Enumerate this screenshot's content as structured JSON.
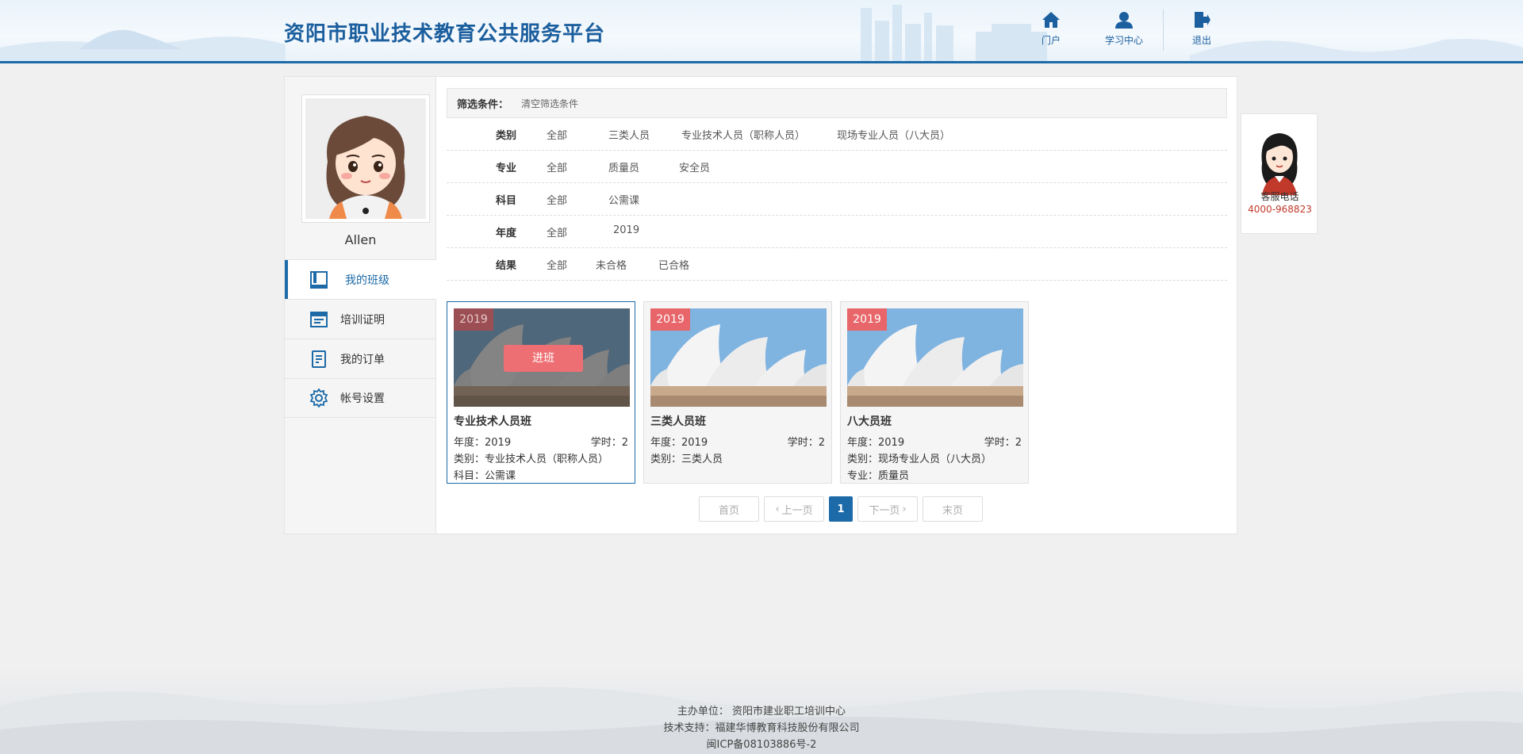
{
  "header": {
    "site_title": "资阳市职业技术教育公共服务平台",
    "nav": [
      {
        "label": "门户",
        "icon": "home-icon"
      },
      {
        "label": "学习中心",
        "icon": "user-icon"
      },
      {
        "label": "退出",
        "icon": "logout-icon"
      }
    ]
  },
  "sidebar": {
    "username": "Allen",
    "menu": [
      {
        "label": "我的班级",
        "icon": "book-icon",
        "active": true
      },
      {
        "label": "培训证明",
        "icon": "certificate-icon",
        "active": false
      },
      {
        "label": "我的订单",
        "icon": "order-icon",
        "active": false
      },
      {
        "label": "帐号设置",
        "icon": "gear-icon",
        "active": false
      }
    ]
  },
  "filter": {
    "title": "筛选条件：",
    "clear": "清空筛选条件",
    "rows": [
      {
        "label": "类别",
        "options": [
          "全部",
          "三类人员",
          "专业技术人员（职称人员）",
          "现场专业人员（八大员）"
        ]
      },
      {
        "label": "专业",
        "options": [
          "全部",
          "质量员",
          "安全员"
        ]
      },
      {
        "label": "科目",
        "options": [
          "全部",
          "公需课"
        ]
      },
      {
        "label": "年度",
        "options": [
          "全部",
          "2019"
        ]
      },
      {
        "label": "结果",
        "options": [
          "全部",
          "未合格",
          "已合格"
        ]
      }
    ]
  },
  "cards": [
    {
      "year": "2019",
      "title": "专业技术人员班",
      "line1": "年度：2019",
      "hours": "学时：2",
      "line2": "类别：专业技术人员（职称人员）",
      "line3": "科目：公需课",
      "enter_label": "进班",
      "selected": true
    },
    {
      "year": "2019",
      "title": "三类人员班",
      "line1": "年度：2019",
      "hours": "学时：2",
      "line2": "类别：三类人员",
      "line3": "",
      "selected": false
    },
    {
      "year": "2019",
      "title": "八大员班",
      "line1": "年度：2019",
      "hours": "学时：2",
      "line2": "类别：现场专业人员（八大员）",
      "line3": "专业：质量员",
      "selected": false
    }
  ],
  "pager": {
    "first": "首页",
    "prev": "上一页",
    "current": "1",
    "next": "下一页",
    "last": "末页"
  },
  "service": {
    "label": "客服电话",
    "phone": "4000-968823"
  },
  "footer": {
    "host": "主办单位： 资阳市建业职工培训中心",
    "tech": "技术支持：福建华博教育科技股份有限公司",
    "icp": "闽ICP备08103886号-2"
  },
  "colors": {
    "brand_blue": "#1c6aa8",
    "badge_red": "#e8666a",
    "phone_red": "#c0392b"
  }
}
